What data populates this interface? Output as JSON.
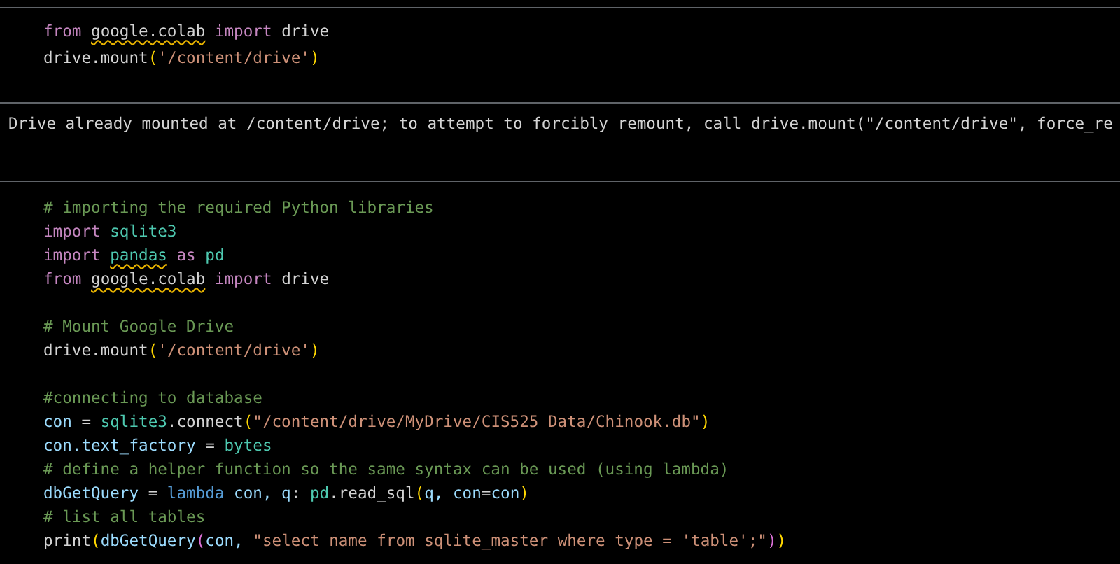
{
  "cells": [
    {
      "kind": "code",
      "blocks": [
        [
          [
            {
              "text": "from ",
              "kind": "kw",
              "warning": false
            },
            {
              "text": "google.colab",
              "kind": "plain",
              "warning": true
            },
            {
              "text": " import ",
              "kind": "kw",
              "warning": false
            },
            {
              "text": "drive",
              "kind": "plain",
              "warning": false
            }
          ],
          [
            {
              "text": "drive.mount",
              "kind": "plain",
              "warning": false
            },
            {
              "text": "(",
              "kind": "paren",
              "warning": false
            },
            {
              "text": "'/content/drive'",
              "kind": "str",
              "warning": false
            },
            {
              "text": ")",
              "kind": "paren",
              "warning": false
            }
          ]
        ]
      ]
    },
    {
      "kind": "output",
      "text": "Drive already mounted at /content/drive; to attempt to forcibly remount, call drive.mount(\"/content/drive\", force_re"
    },
    {
      "kind": "code",
      "blocks": [
        [
          [
            {
              "text": "# importing the required Python libraries",
              "kind": "cmt",
              "warning": false
            }
          ],
          [
            {
              "text": "import ",
              "kind": "kw",
              "warning": false
            },
            {
              "text": "sqlite3",
              "kind": "mod",
              "warning": false
            }
          ],
          [
            {
              "text": "import ",
              "kind": "kw",
              "warning": false
            },
            {
              "text": "pandas",
              "kind": "mod",
              "warning": true
            },
            {
              "text": " as ",
              "kind": "kw",
              "warning": false
            },
            {
              "text": "pd",
              "kind": "mod",
              "warning": false
            }
          ],
          [
            {
              "text": "from ",
              "kind": "kw",
              "warning": false
            },
            {
              "text": "google.colab",
              "kind": "plain",
              "warning": true
            },
            {
              "text": " import ",
              "kind": "kw",
              "warning": false
            },
            {
              "text": "drive",
              "kind": "plain",
              "warning": false
            }
          ]
        ],
        [
          [
            {
              "text": "# Mount Google Drive",
              "kind": "cmt",
              "warning": false
            }
          ],
          [
            {
              "text": "drive.mount",
              "kind": "plain",
              "warning": false
            },
            {
              "text": "(",
              "kind": "paren",
              "warning": false
            },
            {
              "text": "'/content/drive'",
              "kind": "str",
              "warning": false
            },
            {
              "text": ")",
              "kind": "paren",
              "warning": false
            }
          ]
        ],
        [
          [
            {
              "text": "#connecting to database",
              "kind": "cmt",
              "warning": false
            }
          ],
          [
            {
              "text": "con",
              "kind": "var",
              "warning": false
            },
            {
              "text": " = ",
              "kind": "plain",
              "warning": false
            },
            {
              "text": "sqlite3",
              "kind": "mod",
              "warning": false
            },
            {
              "text": ".connect",
              "kind": "plain",
              "warning": false
            },
            {
              "text": "(",
              "kind": "paren",
              "warning": false
            },
            {
              "text": "\"/content/drive/MyDrive/CIS525 Data/Chinook.db\"",
              "kind": "str",
              "warning": false
            },
            {
              "text": ")",
              "kind": "paren",
              "warning": false
            }
          ],
          [
            {
              "text": "con.text_factory",
              "kind": "var",
              "warning": false
            },
            {
              "text": " = ",
              "kind": "plain",
              "warning": false
            },
            {
              "text": "bytes",
              "kind": "mod",
              "warning": false
            }
          ],
          [
            {
              "text": "# define a helper function so the same syntax can be used (using lambda)",
              "kind": "cmt",
              "warning": false
            }
          ],
          [
            {
              "text": "dbGetQuery",
              "kind": "var",
              "warning": false
            },
            {
              "text": " = ",
              "kind": "plain",
              "warning": false
            },
            {
              "text": "lambda",
              "kind": "lambda",
              "warning": false
            },
            {
              "text": " con, q",
              "kind": "var",
              "warning": false
            },
            {
              "text": ": ",
              "kind": "plain",
              "warning": false
            },
            {
              "text": "pd",
              "kind": "mod",
              "warning": false
            },
            {
              "text": ".read_sql",
              "kind": "plain",
              "warning": false
            },
            {
              "text": "(",
              "kind": "paren",
              "warning": false
            },
            {
              "text": "q, con",
              "kind": "var",
              "warning": false
            },
            {
              "text": "=",
              "kind": "plain",
              "warning": false
            },
            {
              "text": "con",
              "kind": "var",
              "warning": false
            },
            {
              "text": ")",
              "kind": "paren",
              "warning": false
            }
          ],
          [
            {
              "text": "# list all tables",
              "kind": "cmt",
              "warning": false
            }
          ],
          [
            {
              "text": "print",
              "kind": "plain",
              "warning": false
            },
            {
              "text": "(",
              "kind": "paren",
              "warning": false
            },
            {
              "text": "dbGetQuery",
              "kind": "var",
              "warning": false
            },
            {
              "text": "(",
              "kind": "paren2",
              "warning": false
            },
            {
              "text": "con, ",
              "kind": "var",
              "warning": false
            },
            {
              "text": "\"select name from sqlite_master where type = 'table';\"",
              "kind": "str",
              "warning": false
            },
            {
              "text": ")",
              "kind": "paren2",
              "warning": false
            },
            {
              "text": ")",
              "kind": "paren",
              "warning": false
            }
          ]
        ]
      ]
    }
  ]
}
